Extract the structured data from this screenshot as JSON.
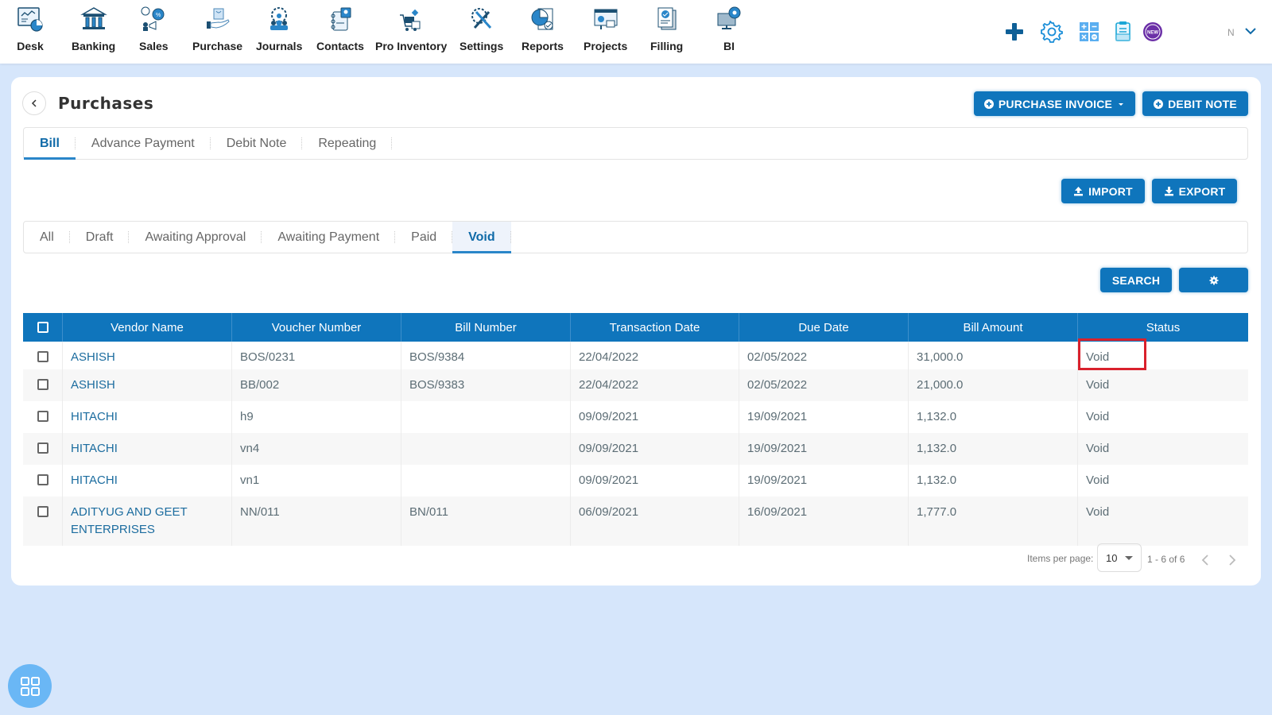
{
  "nav": {
    "items": [
      {
        "label": "Desk",
        "icon": "desk-icon"
      },
      {
        "label": "Banking",
        "icon": "bank-icon"
      },
      {
        "label": "Sales",
        "icon": "sales-icon"
      },
      {
        "label": "Purchase",
        "icon": "purchase-icon"
      },
      {
        "label": "Journals",
        "icon": "journals-icon"
      },
      {
        "label": "Contacts",
        "icon": "contacts-icon"
      },
      {
        "label": "Pro Inventory",
        "icon": "inventory-icon"
      },
      {
        "label": "Settings",
        "icon": "settings-tools-icon"
      },
      {
        "label": "Reports",
        "icon": "reports-icon"
      },
      {
        "label": "Projects",
        "icon": "projects-icon"
      },
      {
        "label": "Filling",
        "icon": "filling-icon"
      },
      {
        "label": "BI",
        "icon": "bi-icon"
      }
    ],
    "right_icons": [
      "plus-icon",
      "gear-icon",
      "calculator-icon",
      "clipboard-icon",
      "new-badge-icon"
    ],
    "new_badge_text": "NEW",
    "user_initial": "N"
  },
  "page": {
    "title": "Purchases",
    "purchase_invoice_label": "PURCHASE INVOICE",
    "debit_note_label": "DEBIT NOTE",
    "import_label": "IMPORT",
    "export_label": "EXPORT",
    "search_label": "SEARCH"
  },
  "type_tabs": [
    {
      "label": "Bill",
      "active": true
    },
    {
      "label": "Advance Payment",
      "active": false
    },
    {
      "label": "Debit Note",
      "active": false
    },
    {
      "label": "Repeating",
      "active": false
    }
  ],
  "status_tabs": [
    {
      "label": "All",
      "active": false
    },
    {
      "label": "Draft",
      "active": false
    },
    {
      "label": "Awaiting Approval",
      "active": false
    },
    {
      "label": "Awaiting Payment",
      "active": false
    },
    {
      "label": "Paid",
      "active": false
    },
    {
      "label": "Void",
      "active": true
    }
  ],
  "table": {
    "columns": [
      "Vendor Name",
      "Voucher Number",
      "Bill Number",
      "Transaction Date",
      "Due Date",
      "Bill Amount",
      "Status"
    ],
    "rows": [
      {
        "vendor": "ASHISH",
        "voucher": "BOS/0231",
        "bill": "BOS/9384",
        "txn_date": "22/04/2022",
        "due_date": "02/05/2022",
        "amount": "31,000.0",
        "status": "Void"
      },
      {
        "vendor": "ASHISH",
        "voucher": "BB/002",
        "bill": "BOS/9383",
        "txn_date": "22/04/2022",
        "due_date": "02/05/2022",
        "amount": "21,000.0",
        "status": "Void"
      },
      {
        "vendor": "HITACHI",
        "voucher": "h9",
        "bill": "",
        "txn_date": "09/09/2021",
        "due_date": "19/09/2021",
        "amount": "1,132.0",
        "status": "Void"
      },
      {
        "vendor": "HITACHI",
        "voucher": "vn4",
        "bill": "",
        "txn_date": "09/09/2021",
        "due_date": "19/09/2021",
        "amount": "1,132.0",
        "status": "Void"
      },
      {
        "vendor": "HITACHI",
        "voucher": "vn1",
        "bill": "",
        "txn_date": "09/09/2021",
        "due_date": "19/09/2021",
        "amount": "1,132.0",
        "status": "Void"
      },
      {
        "vendor": "ADITYUG AND GEET ENTERPRISES",
        "voucher": "NN/011",
        "bill": "BN/011",
        "txn_date": "06/09/2021",
        "due_date": "16/09/2021",
        "amount": "1,777.0",
        "status": "Void"
      }
    ]
  },
  "pagination": {
    "items_per_page_label": "Items per page:",
    "items_per_page": "10",
    "range": "1 - 6 of 6"
  },
  "colors": {
    "primary": "#0f75bc",
    "highlight": "#d9212c",
    "background": "#d6e6fb"
  }
}
